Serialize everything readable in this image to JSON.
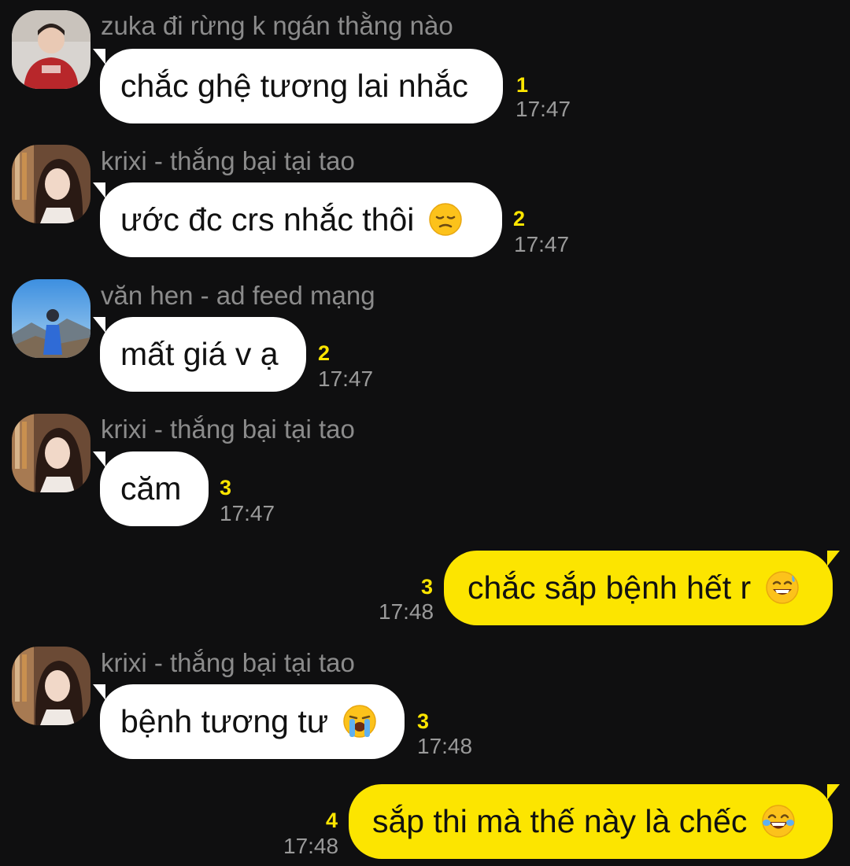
{
  "messages": [
    {
      "sender": "zuka đi rừng k ngán thằng nào",
      "text": "chắc ghệ tương lai nhắc",
      "unread": "1",
      "time": "17:47",
      "avatar": "avatar-zuka"
    },
    {
      "sender": "krixi - thắng bại tại tao",
      "text": "ước đc crs nhắc thôi",
      "emoji": "pensive-face-icon",
      "unread": "2",
      "time": "17:47",
      "avatar": "avatar-krixi"
    },
    {
      "sender": "văn hen - ad feed mạng",
      "text": "mất giá v ạ",
      "unread": "2",
      "time": "17:47",
      "avatar": "avatar-van-hen"
    },
    {
      "sender": "krixi - thắng bại tại tao",
      "text": "căm",
      "unread": "3",
      "time": "17:47",
      "avatar": "avatar-krixi"
    },
    {
      "text": "chắc sắp bệnh hết r",
      "emoji": "grinning-sweat-face-icon",
      "unread": "3",
      "time": "17:48"
    },
    {
      "sender": "krixi - thắng bại tại tao",
      "text": "bệnh tương tư",
      "emoji": "loudly-crying-face-icon",
      "unread": "3",
      "time": "17:48",
      "avatar": "avatar-krixi"
    },
    {
      "text": "sắp thi mà thế này là chếc",
      "emoji": "tears-of-joy-face-icon",
      "unread": "4",
      "time": "17:48"
    }
  ],
  "colors": {
    "background": "#0f0f10",
    "incoming_bubble": "#ffffff",
    "outgoing_bubble": "#fce500",
    "unread": "#fce500",
    "meta": "#9a9a9a"
  }
}
